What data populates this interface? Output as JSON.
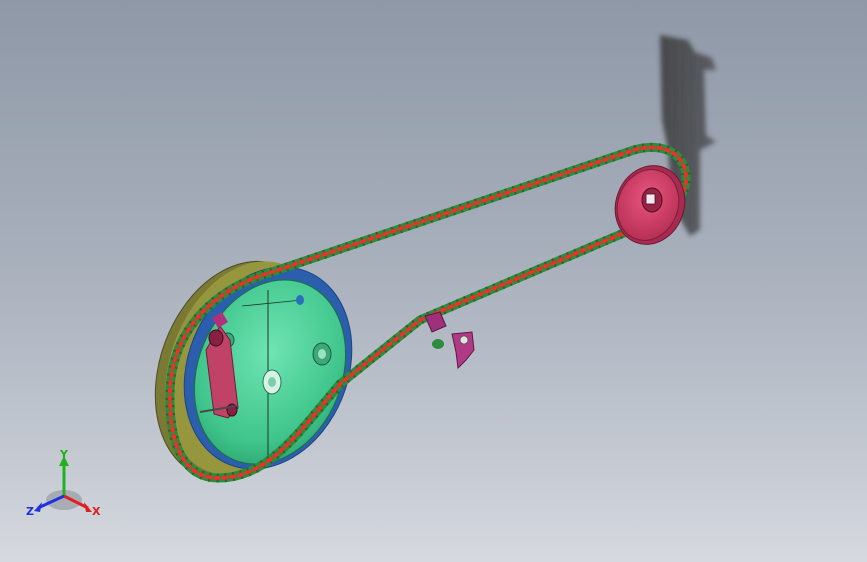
{
  "viewport": {
    "background_top": "#8f98a7",
    "background_bottom": "#d6d9df"
  },
  "model": {
    "chain_link_color": "#2e8b3e",
    "chain_roller_color": "#e8322a",
    "large_sprocket_color": "#4fd29a",
    "small_sprocket_color": "#d43a62",
    "tensioner_color": "#b0307a",
    "rim_color": "#8a8a3c"
  },
  "triad": {
    "x_label": "X",
    "y_label": "Y",
    "z_label": "Z",
    "x_color": "#e02020",
    "y_color": "#20b020",
    "z_color": "#2030e0"
  }
}
